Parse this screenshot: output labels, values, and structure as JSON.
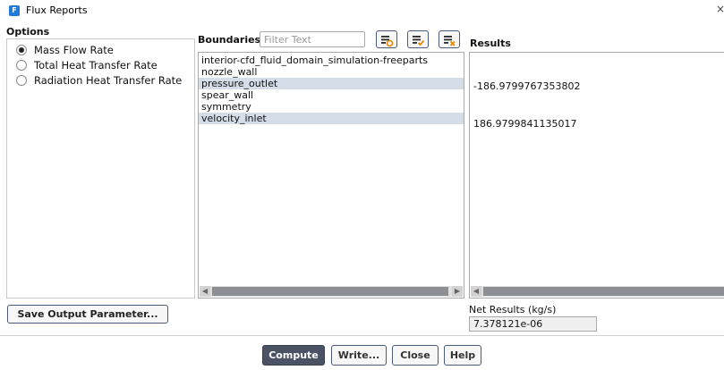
{
  "window": {
    "title": "Flux Reports",
    "app_icon_letter": "F",
    "close_glyph": "×"
  },
  "options": {
    "title": "Options",
    "items": [
      {
        "label": "Mass Flow Rate",
        "checked": true
      },
      {
        "label": "Total Heat Transfer Rate",
        "checked": false
      },
      {
        "label": "Radiation Heat Transfer Rate",
        "checked": false
      }
    ]
  },
  "boundaries": {
    "label": "Boundaries",
    "filter_placeholder": "Filter Text",
    "toolbar_icons": [
      "list-select-all-icon",
      "list-check-icon",
      "list-deselect-icon"
    ],
    "items": [
      {
        "label": "interior-cfd_fluid_domain_simulation-freeparts",
        "selected": false
      },
      {
        "label": "nozzle_wall",
        "selected": false
      },
      {
        "label": "pressure_outlet",
        "selected": true
      },
      {
        "label": "spear_wall",
        "selected": false
      },
      {
        "label": "symmetry",
        "selected": false
      },
      {
        "label": "velocity_inlet",
        "selected": true
      }
    ]
  },
  "results": {
    "label": "Results",
    "values": [
      "-186.9799767353802",
      "186.9799841135017"
    ]
  },
  "net": {
    "label": "Net Results (kg/s)",
    "value": "7.378121e-06"
  },
  "buttons": {
    "save_output": "Save Output Parameter...",
    "compute": "Compute",
    "write": "Write...",
    "close": "Close",
    "help": "Help"
  },
  "colors": {
    "selection": "#d5dde9",
    "primary_button": "#4a5264",
    "accent_icon": "#1e7bd6"
  }
}
